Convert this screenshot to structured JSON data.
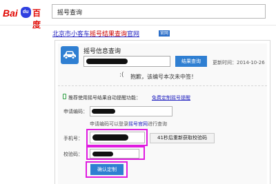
{
  "header": {
    "logo_latin": "Bai",
    "logo_paw": "du",
    "logo_chinese": "百度",
    "search_query": "摇号查询"
  },
  "result": {
    "title_part1": "北京市小客车",
    "title_keyword": "摇号结果查询",
    "title_part2": "官网",
    "badge": "官网"
  },
  "card": {
    "title": "摇号信息查询",
    "query_button": "结果查询",
    "update_time": "更新时间：2014-10-26",
    "face": ":(",
    "result_message": "抱歉，该编号本次未中签！",
    "promo_text": "推荐使用摇号结果自动提醒功能：",
    "promo_link": "免费定制摇号提醒",
    "promo_suffix": "",
    "apply_code_label": "申请编码：",
    "note_prefix": "申请编码可以登录",
    "note_link": "摇号官网",
    "note_suffix": "进行查询",
    "phone_label": "手机号：",
    "sms_button": "41秒后重新获取校验码",
    "captcha_label": "校验码：",
    "confirm_button": "确认定制"
  },
  "colors": {
    "brand_red": "#e10601",
    "baidu_blue": "#2e3fe0",
    "button_blue": "#2f7fd2",
    "link_blue": "#1f1fbf",
    "highlight_magenta": "#e01ae0"
  },
  "icons": [
    "baidu-paw-icon",
    "car-icon",
    "sad-face-icon",
    "phone-icon"
  ]
}
